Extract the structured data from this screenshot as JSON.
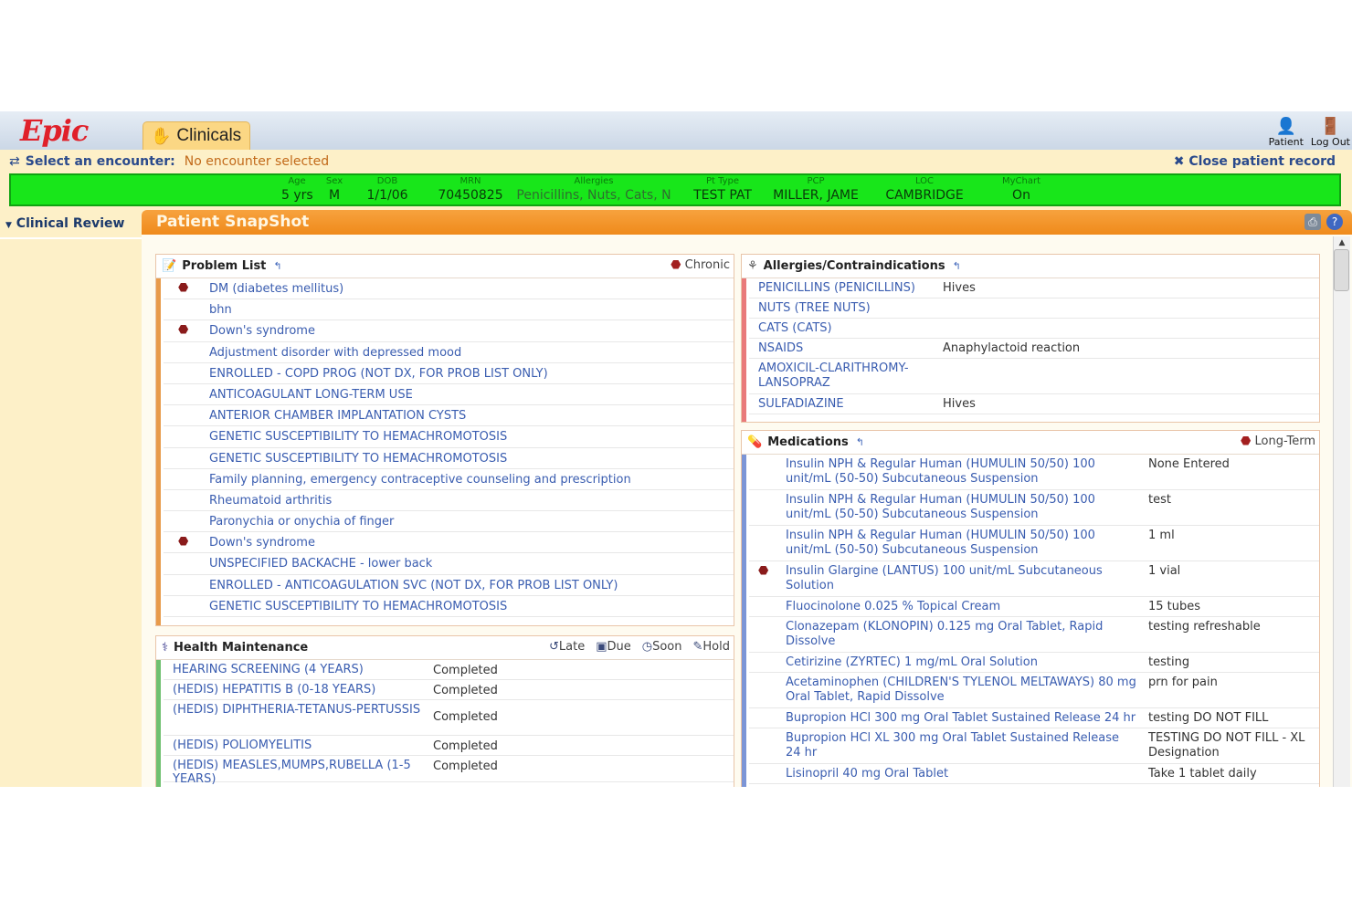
{
  "app": {
    "logo_text": "Epic",
    "tab": {
      "label": "Clinicals"
    },
    "top_actions": [
      {
        "label": "Patient",
        "icon": "patient-icon"
      },
      {
        "label": "Log Out",
        "icon": "logout-icon"
      }
    ]
  },
  "encounter": {
    "label": "Select an encounter:",
    "value": "No encounter selected",
    "close_label": "Close patient record"
  },
  "banner": {
    "columns": [
      {
        "header": "Age",
        "value": "5 yrs."
      },
      {
        "header": "Sex",
        "value": "M"
      },
      {
        "header": "DOB",
        "value": "1/1/06"
      },
      {
        "header": "MRN",
        "value": "70450825"
      },
      {
        "header": "Allergies",
        "value": "Penicillins, Nuts, Cats, N"
      },
      {
        "header": "Pt Type",
        "value": "TEST PAT"
      },
      {
        "header": "PCP",
        "value": "MILLER, JAME"
      },
      {
        "header": "LOC",
        "value": "CAMBRIDGE"
      },
      {
        "header": "MyChart",
        "value": "On"
      }
    ],
    "color": "#18e61a"
  },
  "sidebar": {
    "items": [
      {
        "label": "Clinical Review"
      }
    ]
  },
  "main": {
    "title": "Patient SnapShot",
    "header_color": "#ef8a1b"
  },
  "problem_list": {
    "title": "Problem List",
    "legend": "Chronic",
    "items": [
      {
        "text": "DM (diabetes mellitus)",
        "chronic": true
      },
      {
        "text": "bhn",
        "chronic": false
      },
      {
        "text": "Down's syndrome",
        "chronic": true
      },
      {
        "text": "Adjustment disorder with depressed mood",
        "chronic": false
      },
      {
        "text": "ENROLLED - COPD PROG (NOT DX, FOR PROB LIST ONLY)",
        "chronic": false
      },
      {
        "text": "ANTICOAGULANT LONG-TERM USE",
        "chronic": false
      },
      {
        "text": "ANTERIOR CHAMBER IMPLANTATION CYSTS",
        "chronic": false
      },
      {
        "text": "GENETIC SUSCEPTIBILITY TO HEMACHROMOTOSIS",
        "chronic": false
      },
      {
        "text": "GENETIC SUSCEPTIBILITY TO HEMACHROMOTOSIS",
        "chronic": false
      },
      {
        "text": "Family planning, emergency contraceptive counseling and prescription",
        "chronic": false
      },
      {
        "text": "Rheumatoid arthritis",
        "chronic": false
      },
      {
        "text": "Paronychia or onychia of finger",
        "chronic": false
      },
      {
        "text": "Down's syndrome",
        "chronic": true
      },
      {
        "text": "UNSPECIFIED BACKACHE - lower back",
        "chronic": false
      },
      {
        "text": "ENROLLED - ANTICOAGULATION SVC (NOT DX, FOR PROB LIST ONLY)",
        "chronic": false
      },
      {
        "text": "GENETIC SUSCEPTIBILITY TO HEMACHROMOTOSIS",
        "chronic": false
      }
    ]
  },
  "health_maintenance": {
    "title": "Health Maintenance",
    "legend": [
      {
        "label": "Late",
        "icon": "late-icon"
      },
      {
        "label": "Due",
        "icon": "due-icon"
      },
      {
        "label": "Soon",
        "icon": "soon-icon"
      },
      {
        "label": "Hold",
        "icon": "hold-icon"
      }
    ],
    "items": [
      {
        "name": "HEARING SCREENING (4 YEARS)",
        "status": "Completed"
      },
      {
        "name": "(HEDIS) HEPATITIS B (0-18 YEARS)",
        "status": "Completed"
      },
      {
        "name": "(HEDIS) DIPHTHERIA-TETANUS-PERTUSSIS",
        "status": "Completed"
      },
      {
        "name": "(HEDIS) POLIOMYELITIS",
        "status": "Completed"
      },
      {
        "name": "(HEDIS) MEASLES,MUMPS,RUBELLA (1-5 YEARS)",
        "status": "Completed"
      }
    ]
  },
  "allergies": {
    "title": "Allergies/Contraindications",
    "items": [
      {
        "name": "PENICILLINS (PENICILLINS)",
        "reaction": "Hives"
      },
      {
        "name": "NUTS (TREE NUTS)",
        "reaction": ""
      },
      {
        "name": "CATS (CATS)",
        "reaction": ""
      },
      {
        "name": "NSAIDS",
        "reaction": "Anaphylactoid reaction"
      },
      {
        "name": "AMOXICIL-CLARITHROMY-LANSOPRAZ",
        "reaction": ""
      },
      {
        "name": "SULFADIAZINE",
        "reaction": "Hives"
      }
    ]
  },
  "medications": {
    "title": "Medications",
    "legend": "Long-Term",
    "items": [
      {
        "name": "Insulin NPH & Regular Human (HUMULIN 50/50) 100 unit/mL (50-50) Subcutaneous Suspension",
        "sig": "None Entered",
        "long_term": false
      },
      {
        "name": "Insulin NPH & Regular Human (HUMULIN 50/50) 100 unit/mL (50-50) Subcutaneous Suspension",
        "sig": "test",
        "long_term": false
      },
      {
        "name": "Insulin NPH & Regular Human (HUMULIN 50/50) 100 unit/mL (50-50) Subcutaneous Suspension",
        "sig": "1 ml",
        "long_term": false
      },
      {
        "name": "Insulin Glargine (LANTUS) 100 unit/mL Subcutaneous Solution",
        "sig": "1 vial",
        "long_term": true
      },
      {
        "name": "Fluocinolone 0.025 % Topical Cream",
        "sig": "15 tubes",
        "long_term": false
      },
      {
        "name": "Clonazepam (KLONOPIN) 0.125 mg Oral Tablet, Rapid Dissolve",
        "sig": "testing refreshable",
        "long_term": false
      },
      {
        "name": "Cetirizine (ZYRTEC) 1 mg/mL Oral Solution",
        "sig": "testing",
        "long_term": false
      },
      {
        "name": "Acetaminophen (CHILDREN'S TYLENOL MELTAWAYS) 80 mg Oral Tablet, Rapid Dissolve",
        "sig": "prn for pain",
        "long_term": false
      },
      {
        "name": "Bupropion HCl 300 mg Oral Tablet Sustained Release 24 hr",
        "sig": "testing DO NOT FILL",
        "long_term": false
      },
      {
        "name": "Bupropion HCl XL 300 mg Oral Tablet Sustained Release 24 hr",
        "sig": "TESTING DO NOT FILL - XL Designation",
        "long_term": false
      },
      {
        "name": "Lisinopril 40 mg Oral Tablet",
        "sig": "Take 1 tablet daily",
        "long_term": false
      }
    ]
  }
}
